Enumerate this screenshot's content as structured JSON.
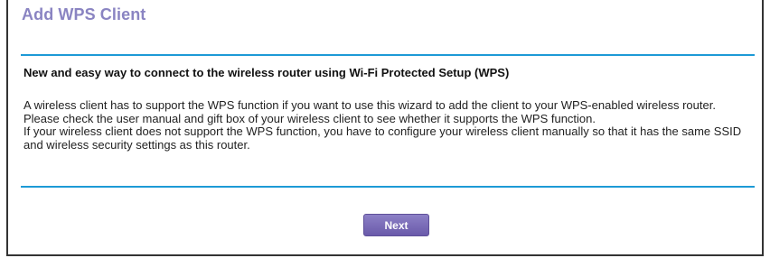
{
  "page": {
    "title": "Add WPS Client"
  },
  "intro": {
    "heading": "New and easy way to connect to the wireless router using Wi-Fi Protected Setup (WPS)",
    "paragraphs": [
      "A wireless client has to support the WPS function if you want to use this wizard to add the client to your WPS-enabled wireless router.",
      "Please check the user manual and gift box of your wireless client to see whether it supports the WPS function.",
      "If your wireless client does not support the WPS function, you have to configure your wireless client manually so that it has the same SSID and wireless security settings as this router."
    ]
  },
  "actions": {
    "next_label": "Next"
  },
  "colors": {
    "title": "#8a84c2",
    "rule": "#1d9ad6",
    "button": "#7466b6"
  }
}
